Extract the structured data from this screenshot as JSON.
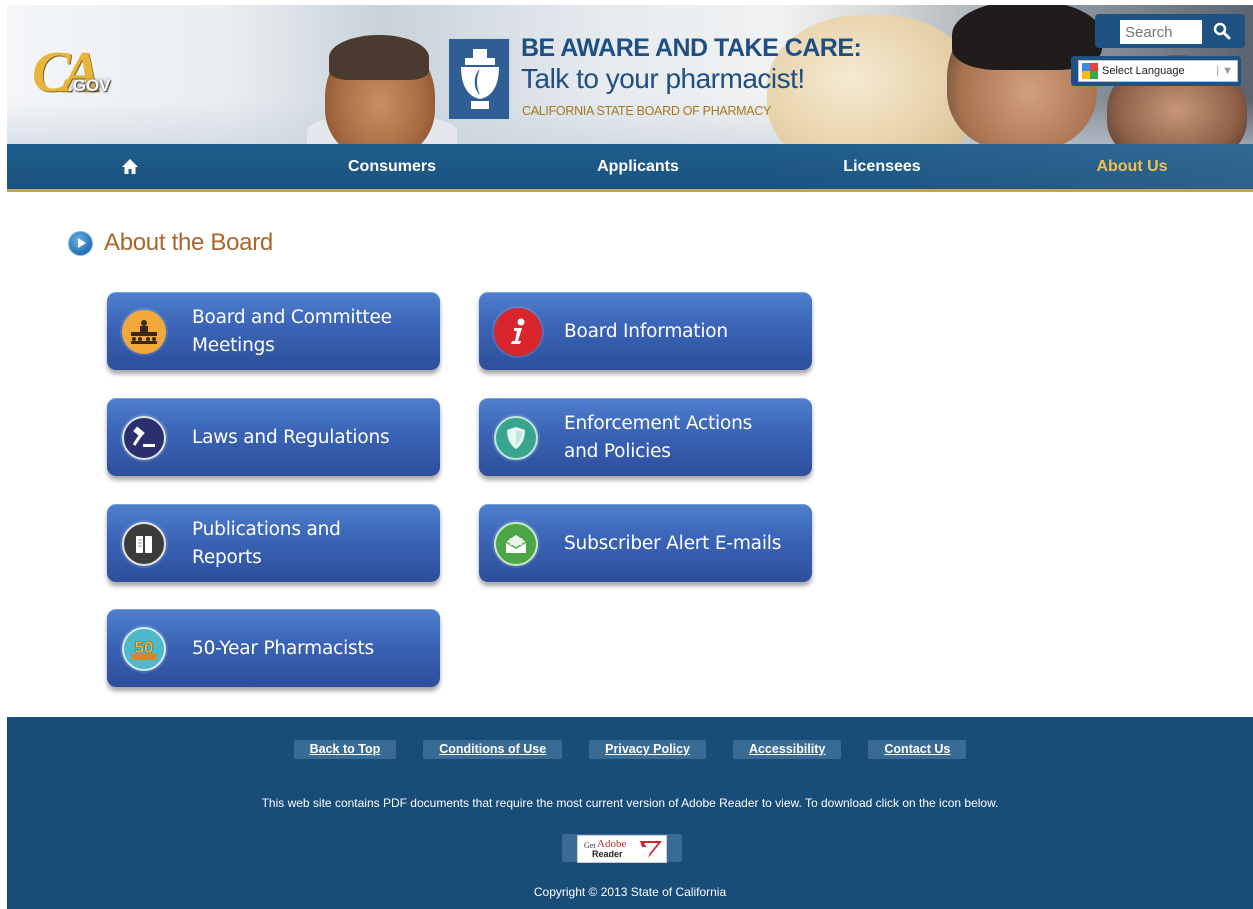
{
  "header": {
    "logo": {
      "main": "CA",
      "suffix": ".GOV"
    },
    "campaign": {
      "title": "BE AWARE AND TAKE CARE:",
      "subtitle": "Talk to your pharmacist!",
      "organization": "CALIFORNIA STATE BOARD OF PHARMACY"
    },
    "search": {
      "placeholder": "Search",
      "icon": "search-icon"
    },
    "language": {
      "label": "Select Language",
      "separator": "|",
      "arrow": "▼"
    }
  },
  "nav": {
    "home_icon": "home-icon",
    "items": [
      {
        "label": "Consumers",
        "active": false
      },
      {
        "label": "Applicants",
        "active": false
      },
      {
        "label": "Licensees",
        "active": false
      },
      {
        "label": "About Us",
        "active": true
      }
    ]
  },
  "main": {
    "heading": "About the Board",
    "tiles": [
      {
        "label": "Board and Committee Meetings",
        "icon": "meeting-icon",
        "icon_color": "#f2a93b"
      },
      {
        "label": "Board Information",
        "icon": "info-icon",
        "icon_color": "#d9262c"
      },
      {
        "label": "Laws and Regulations",
        "icon": "gavel-icon",
        "icon_color": "#2b2f6e"
      },
      {
        "label": "Enforcement Actions and Policies",
        "icon": "shield-icon",
        "icon_color": "#3aa58f"
      },
      {
        "label": "Publications and Reports",
        "icon": "book-icon",
        "icon_color": "#3b3b3b"
      },
      {
        "label": "Subscriber Alert E-mails",
        "icon": "email-icon",
        "icon_color": "#4da646"
      },
      {
        "label": "50-Year Pharmacists",
        "icon": "fifty-years-icon",
        "icon_color": "#4fb8c9"
      }
    ]
  },
  "footer": {
    "links": [
      "Back to Top",
      "Conditions of Use",
      "Privacy Policy",
      "Accessibility",
      "Contact Us"
    ],
    "note": "This web site contains PDF documents that require the most current version of Adobe Reader to view. To download click on the icon below.",
    "adobe": {
      "get": "Get",
      "brand": "Adobe",
      "product": "Reader"
    },
    "copyright": "Copyright © 2013 State of California"
  },
  "colors": {
    "nav_bg": "#1f5d8c",
    "nav_active": "#f3c14d",
    "heading": "#a9662a",
    "tile": "#3a63b5",
    "footer_bg": "#184d7a",
    "accent_gold": "#c7a45b"
  }
}
